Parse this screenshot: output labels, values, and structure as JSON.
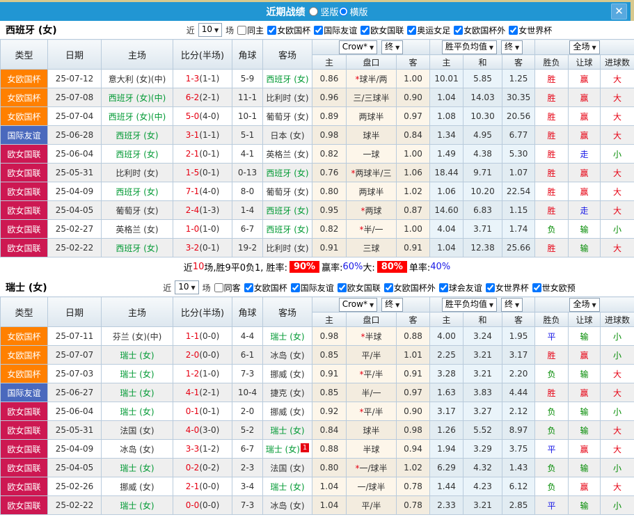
{
  "icons": {
    "close": "✕",
    "dropdown_arrow": "▼"
  },
  "colors": {
    "titlebar": "#2196d3",
    "type_colors": {
      "女欧国杯": "#ff8000",
      "国际友谊": "#4a69bd",
      "欧女国联": "#cd1852"
    },
    "score_red": "#e60012",
    "team_green": "#009933",
    "win_red": "#e60012",
    "lose_green": "#008a00",
    "draw_blue": "#1717e6"
  },
  "titlebar": {
    "title": "近期战绩",
    "view_options": [
      {
        "label": "竖版",
        "checked": false
      },
      {
        "label": "横版",
        "checked": true
      }
    ]
  },
  "table": {
    "main_headers": [
      "类型",
      "日期",
      "主场",
      "比分(半场)",
      "角球",
      "客场"
    ],
    "dropdown_groups": [
      [
        "Crow*",
        "终"
      ],
      [
        "胜平负均值",
        "终"
      ],
      [
        "全场"
      ]
    ],
    "sub_headers": [
      "主",
      "盘口",
      "客",
      "主",
      "和",
      "客",
      "胜负",
      "让球",
      "进球数"
    ]
  },
  "sections": [
    {
      "team": "西班牙 (女)",
      "filter": {
        "near_label": "近",
        "count": "10",
        "unit_label": "场",
        "same_label": "同主",
        "same_checked": false,
        "competitions": [
          {
            "label": "女欧国杯",
            "checked": true
          },
          {
            "label": "国际友谊",
            "checked": true
          },
          {
            "label": "欧女国联",
            "checked": true
          },
          {
            "label": "奥运女足",
            "checked": true
          },
          {
            "label": "女欧国杯外",
            "checked": true
          },
          {
            "label": "女世界杯",
            "checked": true
          }
        ]
      },
      "rows": [
        {
          "type": "女欧国杯",
          "date": "25-07-12",
          "home": "意大利 (女)(中)",
          "home_green": false,
          "score": "1-3",
          "half": "(1-1)",
          "corner": "5-9",
          "away": "西班牙 (女)",
          "away_green": true,
          "away_badge": "",
          "crow_home": "0.86",
          "handicap_star": true,
          "handicap": "球半/两",
          "crow_away": "1.00",
          "avg_win": "10.01",
          "avg_draw": "5.85",
          "avg_lose": "1.25",
          "result": "胜",
          "handicap_result": "赢",
          "goals": "大"
        },
        {
          "type": "女欧国杯",
          "date": "25-07-08",
          "home": "西班牙 (女)(中)",
          "home_green": true,
          "score": "6-2",
          "half": "(2-1)",
          "corner": "11-1",
          "away": "比利时 (女)",
          "away_green": false,
          "away_badge": "",
          "crow_home": "0.96",
          "handicap_star": false,
          "handicap": "三/三球半",
          "crow_away": "0.90",
          "avg_win": "1.04",
          "avg_draw": "14.03",
          "avg_lose": "30.35",
          "result": "胜",
          "handicap_result": "赢",
          "goals": "大"
        },
        {
          "type": "女欧国杯",
          "date": "25-07-04",
          "home": "西班牙 (女)(中)",
          "home_green": true,
          "score": "5-0",
          "half": "(4-0)",
          "corner": "10-1",
          "away": "葡萄牙 (女)",
          "away_green": false,
          "away_badge": "",
          "crow_home": "0.89",
          "handicap_star": false,
          "handicap": "两球半",
          "crow_away": "0.97",
          "avg_win": "1.08",
          "avg_draw": "10.30",
          "avg_lose": "20.56",
          "result": "胜",
          "handicap_result": "赢",
          "goals": "大"
        },
        {
          "type": "国际友谊",
          "date": "25-06-28",
          "home": "西班牙 (女)",
          "home_green": true,
          "score": "3-1",
          "half": "(1-1)",
          "corner": "5-1",
          "away": "日本 (女)",
          "away_green": false,
          "away_badge": "",
          "crow_home": "0.98",
          "handicap_star": false,
          "handicap": "球半",
          "crow_away": "0.84",
          "avg_win": "1.34",
          "avg_draw": "4.95",
          "avg_lose": "6.77",
          "result": "胜",
          "handicap_result": "赢",
          "goals": "大"
        },
        {
          "type": "欧女国联",
          "date": "25-06-04",
          "home": "西班牙 (女)",
          "home_green": true,
          "score": "2-1",
          "half": "(0-1)",
          "corner": "4-1",
          "away": "英格兰 (女)",
          "away_green": false,
          "away_badge": "",
          "crow_home": "0.82",
          "handicap_star": false,
          "handicap": "一球",
          "crow_away": "1.00",
          "avg_win": "1.49",
          "avg_draw": "4.38",
          "avg_lose": "5.30",
          "result": "胜",
          "handicap_result": "走",
          "goals": "小"
        },
        {
          "type": "欧女国联",
          "date": "25-05-31",
          "home": "比利时 (女)",
          "home_green": false,
          "score": "1-5",
          "half": "(0-1)",
          "corner": "0-13",
          "away": "西班牙 (女)",
          "away_green": true,
          "away_badge": "",
          "crow_home": "0.76",
          "handicap_star": true,
          "handicap": "两球半/三",
          "crow_away": "1.06",
          "avg_win": "18.44",
          "avg_draw": "9.71",
          "avg_lose": "1.07",
          "result": "胜",
          "handicap_result": "赢",
          "goals": "大"
        },
        {
          "type": "欧女国联",
          "date": "25-04-09",
          "home": "西班牙 (女)",
          "home_green": true,
          "score": "7-1",
          "half": "(4-0)",
          "corner": "8-0",
          "away": "葡萄牙 (女)",
          "away_green": false,
          "away_badge": "",
          "crow_home": "0.80",
          "handicap_star": false,
          "handicap": "两球半",
          "crow_away": "1.02",
          "avg_win": "1.06",
          "avg_draw": "10.20",
          "avg_lose": "22.54",
          "result": "胜",
          "handicap_result": "赢",
          "goals": "大"
        },
        {
          "type": "欧女国联",
          "date": "25-04-05",
          "home": "葡萄牙 (女)",
          "home_green": false,
          "score": "2-4",
          "half": "(1-3)",
          "corner": "1-4",
          "away": "西班牙 (女)",
          "away_green": true,
          "away_badge": "",
          "crow_home": "0.95",
          "handicap_star": true,
          "handicap": "两球",
          "crow_away": "0.87",
          "avg_win": "14.60",
          "avg_draw": "6.83",
          "avg_lose": "1.15",
          "result": "胜",
          "handicap_result": "走",
          "goals": "大"
        },
        {
          "type": "欧女国联",
          "date": "25-02-27",
          "home": "英格兰 (女)",
          "home_green": false,
          "score": "1-0",
          "half": "(1-0)",
          "corner": "6-7",
          "away": "西班牙 (女)",
          "away_green": true,
          "away_badge": "",
          "crow_home": "0.82",
          "handicap_star": true,
          "handicap": "半/一",
          "crow_away": "1.00",
          "avg_win": "4.04",
          "avg_draw": "3.71",
          "avg_lose": "1.74",
          "result": "负",
          "handicap_result": "输",
          "goals": "小"
        },
        {
          "type": "欧女国联",
          "date": "25-02-22",
          "home": "西班牙 (女)",
          "home_green": true,
          "score": "3-2",
          "half": "(0-1)",
          "corner": "19-2",
          "away": "比利时 (女)",
          "away_green": false,
          "away_badge": "",
          "crow_home": "0.91",
          "handicap_star": false,
          "handicap": "三球",
          "crow_away": "0.91",
          "avg_win": "1.04",
          "avg_draw": "12.38",
          "avg_lose": "25.66",
          "result": "胜",
          "handicap_result": "输",
          "goals": "大"
        }
      ],
      "summary": [
        {
          "text": "近",
          "style": "plain"
        },
        {
          "text": "10",
          "style": "red"
        },
        {
          "text": "场,胜9平0负1, 胜率:",
          "style": "plain"
        },
        {
          "text": "90%",
          "style": "badge"
        },
        {
          "text": " 赢率:",
          "style": "plain"
        },
        {
          "text": "60%",
          "style": "blue"
        },
        {
          "text": " 大:",
          "style": "plain"
        },
        {
          "text": "80%",
          "style": "badge"
        },
        {
          "text": " 单率:",
          "style": "plain"
        },
        {
          "text": "40%",
          "style": "blue"
        }
      ]
    },
    {
      "team": "瑞士 (女)",
      "filter": {
        "near_label": "近",
        "count": "10",
        "unit_label": "场",
        "same_label": "同客",
        "same_checked": false,
        "competitions": [
          {
            "label": "女欧国杯",
            "checked": true
          },
          {
            "label": "国际友谊",
            "checked": true
          },
          {
            "label": "欧女国联",
            "checked": true
          },
          {
            "label": "女欧国杯外",
            "checked": true
          },
          {
            "label": "球会友谊",
            "checked": true
          },
          {
            "label": "女世界杯",
            "checked": true
          },
          {
            "label": "世女欧预",
            "checked": true
          }
        ]
      },
      "rows": [
        {
          "type": "女欧国杯",
          "date": "25-07-11",
          "home": "芬兰 (女)(中)",
          "home_green": false,
          "score": "1-1",
          "half": "(0-0)",
          "corner": "4-4",
          "away": "瑞士 (女)",
          "away_green": true,
          "away_badge": "",
          "crow_home": "0.98",
          "handicap_star": true,
          "handicap": "半球",
          "crow_away": "0.88",
          "avg_win": "4.00",
          "avg_draw": "3.24",
          "avg_lose": "1.95",
          "result": "平",
          "handicap_result": "输",
          "goals": "小"
        },
        {
          "type": "女欧国杯",
          "date": "25-07-07",
          "home": "瑞士 (女)",
          "home_green": true,
          "score": "2-0",
          "half": "(0-0)",
          "corner": "6-1",
          "away": "冰岛 (女)",
          "away_green": false,
          "away_badge": "",
          "crow_home": "0.85",
          "handicap_star": false,
          "handicap": "平/半",
          "crow_away": "1.01",
          "avg_win": "2.25",
          "avg_draw": "3.21",
          "avg_lose": "3.17",
          "result": "胜",
          "handicap_result": "赢",
          "goals": "小"
        },
        {
          "type": "女欧国杯",
          "date": "25-07-03",
          "home": "瑞士 (女)",
          "home_green": true,
          "score": "1-2",
          "half": "(1-0)",
          "corner": "7-3",
          "away": "挪威 (女)",
          "away_green": false,
          "away_badge": "",
          "crow_home": "0.91",
          "handicap_star": true,
          "handicap": "平/半",
          "crow_away": "0.91",
          "avg_win": "3.28",
          "avg_draw": "3.21",
          "avg_lose": "2.20",
          "result": "负",
          "handicap_result": "输",
          "goals": "大"
        },
        {
          "type": "国际友谊",
          "date": "25-06-27",
          "home": "瑞士 (女)",
          "home_green": true,
          "score": "4-1",
          "half": "(2-1)",
          "corner": "10-4",
          "away": "捷克 (女)",
          "away_green": false,
          "away_badge": "",
          "crow_home": "0.85",
          "handicap_star": false,
          "handicap": "半/一",
          "crow_away": "0.97",
          "avg_win": "1.63",
          "avg_draw": "3.83",
          "avg_lose": "4.44",
          "result": "胜",
          "handicap_result": "赢",
          "goals": "大"
        },
        {
          "type": "欧女国联",
          "date": "25-06-04",
          "home": "瑞士 (女)",
          "home_green": true,
          "score": "0-1",
          "half": "(0-1)",
          "corner": "2-0",
          "away": "挪威 (女)",
          "away_green": false,
          "away_badge": "",
          "crow_home": "0.92",
          "handicap_star": true,
          "handicap": "平/半",
          "crow_away": "0.90",
          "avg_win": "3.17",
          "avg_draw": "3.27",
          "avg_lose": "2.12",
          "result": "负",
          "handicap_result": "输",
          "goals": "小"
        },
        {
          "type": "欧女国联",
          "date": "25-05-31",
          "home": "法国 (女)",
          "home_green": false,
          "score": "4-0",
          "half": "(3-0)",
          "corner": "5-2",
          "away": "瑞士 (女)",
          "away_green": true,
          "away_badge": "",
          "crow_home": "0.84",
          "handicap_star": false,
          "handicap": "球半",
          "crow_away": "0.98",
          "avg_win": "1.26",
          "avg_draw": "5.52",
          "avg_lose": "8.97",
          "result": "负",
          "handicap_result": "输",
          "goals": "大"
        },
        {
          "type": "欧女国联",
          "date": "25-04-09",
          "home": "冰岛 (女)",
          "home_green": false,
          "score": "3-3",
          "half": "(1-2)",
          "corner": "6-7",
          "away": "瑞士 (女)",
          "away_green": true,
          "away_badge": "1",
          "crow_home": "0.88",
          "handicap_star": false,
          "handicap": "半球",
          "crow_away": "0.94",
          "avg_win": "1.94",
          "avg_draw": "3.29",
          "avg_lose": "3.75",
          "result": "平",
          "handicap_result": "赢",
          "goals": "大"
        },
        {
          "type": "欧女国联",
          "date": "25-04-05",
          "home": "瑞士 (女)",
          "home_green": true,
          "score": "0-2",
          "half": "(0-2)",
          "corner": "2-3",
          "away": "法国 (女)",
          "away_green": false,
          "away_badge": "",
          "crow_home": "0.80",
          "handicap_star": true,
          "handicap": "一/球半",
          "crow_away": "1.02",
          "avg_win": "6.29",
          "avg_draw": "4.32",
          "avg_lose": "1.43",
          "result": "负",
          "handicap_result": "输",
          "goals": "小"
        },
        {
          "type": "欧女国联",
          "date": "25-02-26",
          "home": "挪威 (女)",
          "home_green": false,
          "score": "2-1",
          "half": "(0-0)",
          "corner": "3-4",
          "away": "瑞士 (女)",
          "away_green": true,
          "away_badge": "",
          "crow_home": "1.04",
          "handicap_star": false,
          "handicap": "一/球半",
          "crow_away": "0.78",
          "avg_win": "1.44",
          "avg_draw": "4.23",
          "avg_lose": "6.12",
          "result": "负",
          "handicap_result": "赢",
          "goals": "大"
        },
        {
          "type": "欧女国联",
          "date": "25-02-22",
          "home": "瑞士 (女)",
          "home_green": true,
          "score": "0-0",
          "half": "(0-0)",
          "corner": "7-3",
          "away": "冰岛 (女)",
          "away_green": false,
          "away_badge": "",
          "crow_home": "1.04",
          "handicap_star": false,
          "handicap": "平/半",
          "crow_away": "0.78",
          "avg_win": "2.33",
          "avg_draw": "3.21",
          "avg_lose": "2.85",
          "result": "平",
          "handicap_result": "输",
          "goals": "小"
        }
      ],
      "summary": null
    }
  ]
}
